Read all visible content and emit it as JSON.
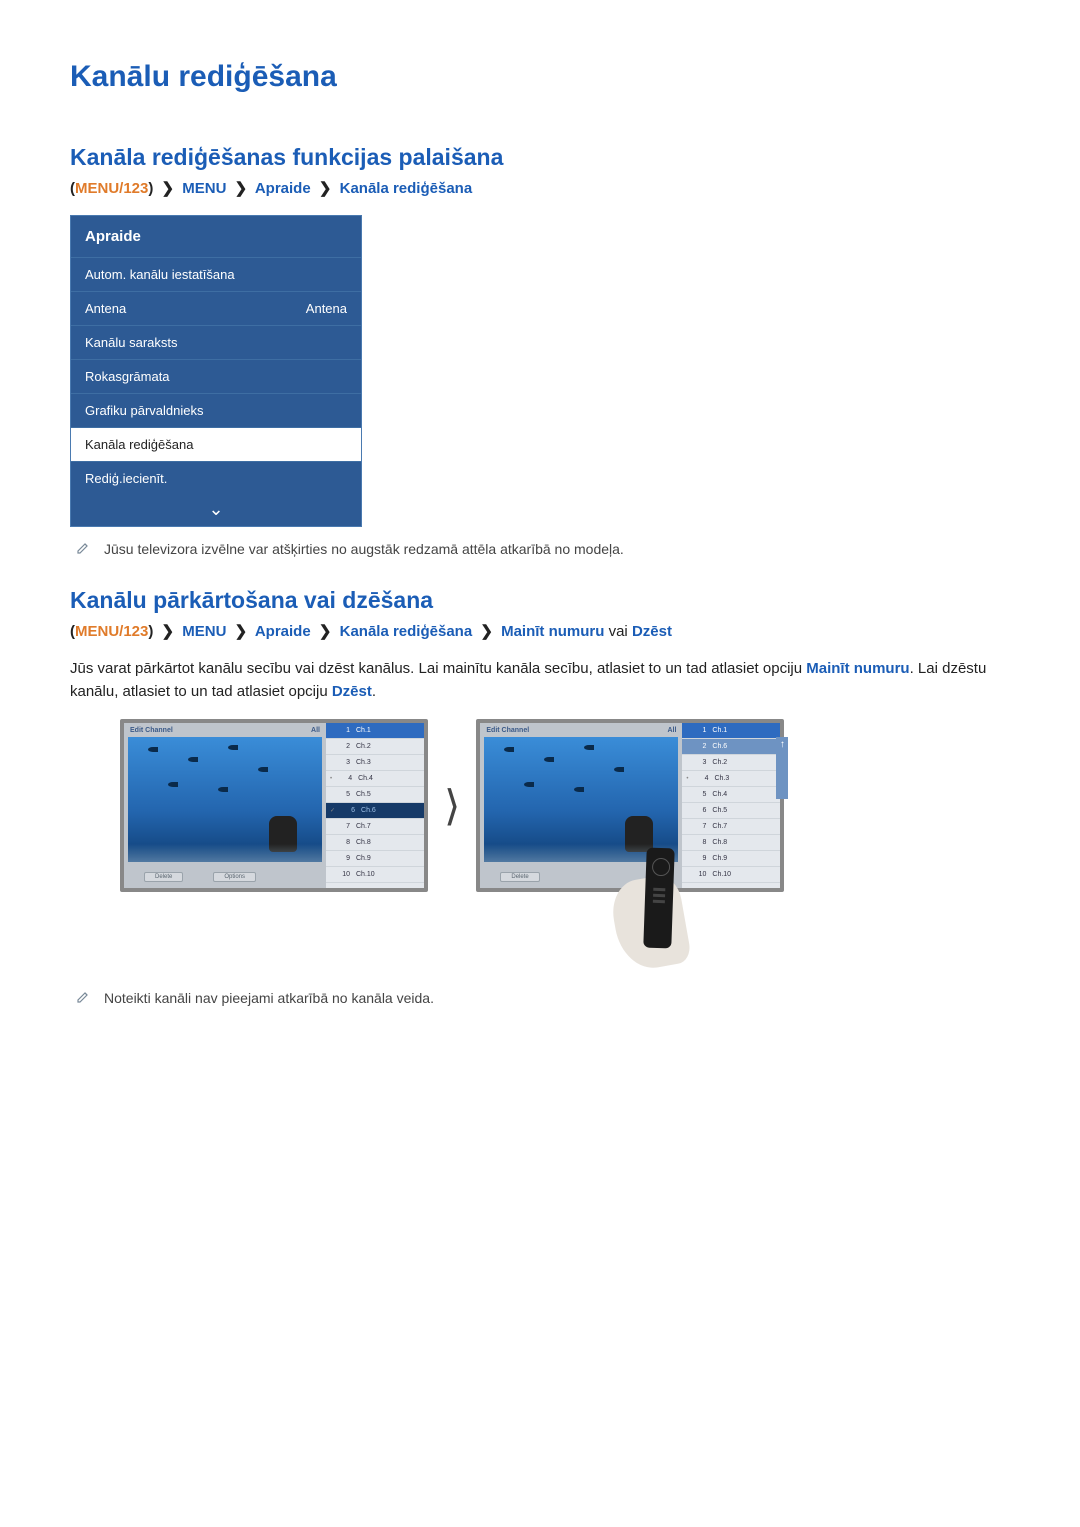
{
  "title": "Kanālu rediģēšana",
  "section1": {
    "heading": "Kanāla rediģēšanas funkcijas palaišana",
    "crumb": {
      "p1": "MENU/123",
      "p2": "MENU",
      "p3": "Apraide",
      "p4": "Kanāla rediģēšana"
    },
    "panel": {
      "title": "Apraide",
      "items": [
        {
          "label": "Autom. kanālu iestatīšana",
          "value": ""
        },
        {
          "label": "Antena",
          "value": "Antena"
        },
        {
          "label": "Kanālu saraksts",
          "value": ""
        },
        {
          "label": "Rokasgrāmata",
          "value": ""
        },
        {
          "label": "Grafiku pārvaldnieks",
          "value": ""
        },
        {
          "label": "Kanāla rediģēšana",
          "value": "",
          "selected": true
        },
        {
          "label": "Rediģ.iecienīt.",
          "value": ""
        }
      ]
    },
    "note": "Jūsu televizora izvēlne var atšķirties no augstāk redzamā attēla atkarībā no modeļa."
  },
  "section2": {
    "heading": "Kanālu pārkārtošana vai dzēšana",
    "crumb": {
      "p1": "MENU/123",
      "p2": "MENU",
      "p3": "Apraide",
      "p4": "Kanāla rediģēšana",
      "p5": "Mainīt numuru",
      "or": "vai",
      "p6": "Dzēst"
    },
    "body": {
      "t1": "Jūs varat pārkārtot kanālu secību vai dzēst kanālus. Lai mainītu kanāla secību, atlasiet to un tad atlasiet opciju ",
      "em1": "Mainīt numuru",
      "t2": ". Lai dzēstu kanālu, atlasiet to un tad atlasiet opciju ",
      "em2": "Dzēst",
      "t3": "."
    },
    "tv": {
      "header_left": "Edit Channel",
      "header_right": "All",
      "btn_delete": "Delete",
      "btn_options": "Options",
      "channels_a": [
        {
          "n": "1",
          "c": "Ch.1",
          "cls": "hl-blue"
        },
        {
          "n": "2",
          "c": "Ch.2"
        },
        {
          "n": "3",
          "c": "Ch.3"
        },
        {
          "n": "4",
          "c": "Ch.4",
          "dot": "•"
        },
        {
          "n": "5",
          "c": "Ch.5"
        },
        {
          "n": "6",
          "c": "Ch.6",
          "cls": "hl-dark",
          "dot": "✓"
        },
        {
          "n": "7",
          "c": "Ch.7"
        },
        {
          "n": "8",
          "c": "Ch.8"
        },
        {
          "n": "9",
          "c": "Ch.9"
        },
        {
          "n": "10",
          "c": "Ch.10"
        }
      ],
      "channels_b": [
        {
          "n": "1",
          "c": "Ch.1",
          "cls": "hl-blue"
        },
        {
          "n": "2",
          "c": "Ch.6",
          "cls": "hl-mid"
        },
        {
          "n": "3",
          "c": "Ch.2"
        },
        {
          "n": "4",
          "c": "Ch.3",
          "dot": "•"
        },
        {
          "n": "5",
          "c": "Ch.4"
        },
        {
          "n": "6",
          "c": "Ch.5"
        },
        {
          "n": "7",
          "c": "Ch.7"
        },
        {
          "n": "8",
          "c": "Ch.8"
        },
        {
          "n": "9",
          "c": "Ch.9"
        },
        {
          "n": "10",
          "c": "Ch.10"
        }
      ]
    },
    "note": "Noteikti kanāli nav pieejami atkarībā no kanāla veida."
  }
}
